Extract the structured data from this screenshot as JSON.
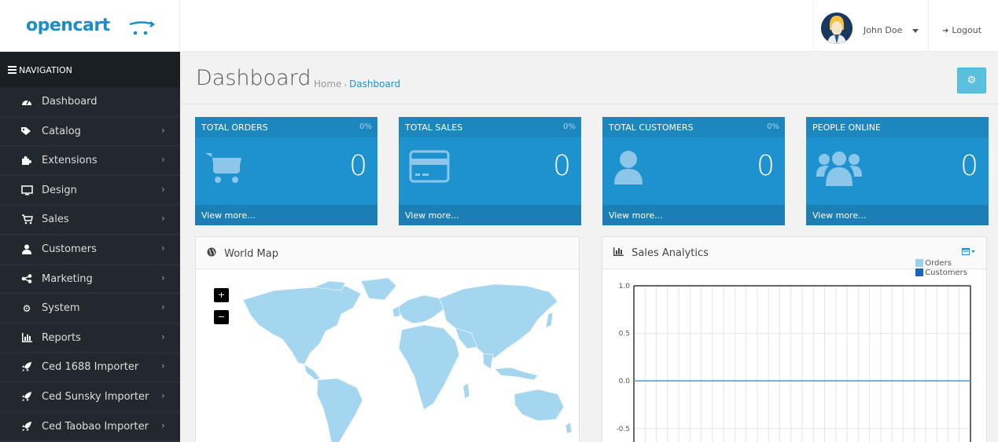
{
  "header": {
    "logo_text": "opencart",
    "user_name": "John Doe",
    "logout_label": "Logout"
  },
  "sidebar": {
    "title": "NAVIGATION",
    "items": [
      {
        "label": "Dashboard",
        "icon": "dashboard-icon",
        "has_children": false
      },
      {
        "label": "Catalog",
        "icon": "tags-icon",
        "has_children": true
      },
      {
        "label": "Extensions",
        "icon": "puzzle-icon",
        "has_children": true
      },
      {
        "label": "Design",
        "icon": "monitor-icon",
        "has_children": true
      },
      {
        "label": "Sales",
        "icon": "shopping-cart-icon",
        "has_children": true
      },
      {
        "label": "Customers",
        "icon": "user-icon",
        "has_children": true
      },
      {
        "label": "Marketing",
        "icon": "share-icon",
        "has_children": true
      },
      {
        "label": "System",
        "icon": "cog-icon",
        "has_children": true
      },
      {
        "label": "Reports",
        "icon": "bar-chart-icon",
        "has_children": true
      },
      {
        "label": "Ced 1688 Importer",
        "icon": "rocket-icon",
        "has_children": true
      },
      {
        "label": "Ced Sunsky Importer",
        "icon": "rocket-icon",
        "has_children": true
      },
      {
        "label": "Ced Taobao Importer",
        "icon": "rocket-icon",
        "has_children": true
      }
    ]
  },
  "page": {
    "title": "Dashboard",
    "breadcrumb": [
      "Home",
      "Dashboard"
    ]
  },
  "tiles": [
    {
      "heading": "TOTAL ORDERS",
      "percent": "0%",
      "value": "0",
      "footer": "View more...",
      "icon": "shopping-cart-icon"
    },
    {
      "heading": "TOTAL SALES",
      "percent": "0%",
      "value": "0",
      "footer": "View more...",
      "icon": "credit-card-icon"
    },
    {
      "heading": "TOTAL CUSTOMERS",
      "percent": "0%",
      "value": "0",
      "footer": "View more...",
      "icon": "user-icon"
    },
    {
      "heading": "PEOPLE ONLINE",
      "percent": "",
      "value": "0",
      "footer": "View more...",
      "icon": "users-icon"
    }
  ],
  "map_panel": {
    "title": "World Map",
    "zoom_in": "+",
    "zoom_out": "−"
  },
  "analytics_panel": {
    "title": "Sales Analytics"
  },
  "chart_data": {
    "type": "line",
    "title": "",
    "ylim": [
      -0.7,
      1.0
    ],
    "yticks": [
      "1.0",
      "0.5",
      "0.0",
      "-0.5"
    ],
    "series": [
      {
        "name": "Orders",
        "values": [
          0,
          0
        ],
        "color": "#9ad0ec"
      },
      {
        "name": "Customers",
        "values": [
          0,
          0
        ],
        "color": "#1565c0"
      }
    ],
    "grid": true,
    "legend": "top-right"
  },
  "colors": {
    "brand": "#1e91cf",
    "sidebar": "#23282e",
    "tile": "#1e91cf",
    "map_land": "#a4d6f0"
  }
}
